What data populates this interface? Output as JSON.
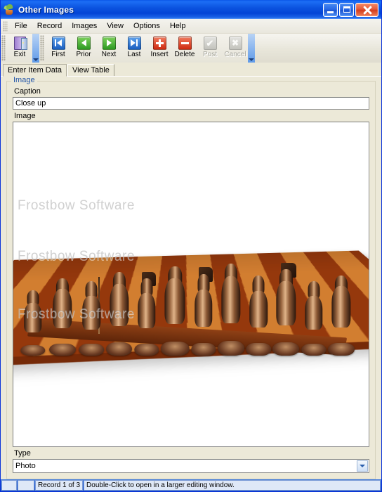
{
  "window": {
    "title": "Other Images",
    "icon": "plant-pot-icon",
    "controls": {
      "minimize": "minimize-button",
      "maximize": "maximize-button",
      "close": "close-button"
    }
  },
  "menu": {
    "items": [
      {
        "label": "File",
        "accel": "F"
      },
      {
        "label": "Record",
        "accel": "R"
      },
      {
        "label": "Images",
        "accel": "I"
      },
      {
        "label": "View",
        "accel": "V"
      },
      {
        "label": "Options",
        "accel": "O"
      },
      {
        "label": "Help",
        "accel": "H"
      }
    ]
  },
  "toolbar": {
    "groups": [
      {
        "name": "file-group",
        "buttons": [
          {
            "label": "Exit",
            "icon": "exit-door-icon",
            "enabled": true
          }
        ]
      },
      {
        "name": "navigation-group",
        "buttons": [
          {
            "label": "First",
            "icon": "first-record-icon",
            "enabled": true
          },
          {
            "label": "Prior",
            "icon": "prior-record-icon",
            "enabled": true
          },
          {
            "label": "Next",
            "icon": "next-record-icon",
            "enabled": true
          },
          {
            "label": "Last",
            "icon": "last-record-icon",
            "enabled": true
          }
        ]
      },
      {
        "name": "edit-group",
        "buttons": [
          {
            "label": "Insert",
            "icon": "insert-plus-icon",
            "enabled": true
          },
          {
            "label": "Delete",
            "icon": "delete-minus-icon",
            "enabled": true
          },
          {
            "label": "Post",
            "icon": "post-check-icon",
            "enabled": false
          },
          {
            "label": "Cancel",
            "icon": "cancel-x-icon",
            "enabled": false
          }
        ]
      }
    ]
  },
  "tabs": {
    "items": [
      {
        "label": "Enter Item Data",
        "active": true
      },
      {
        "label": "View Table",
        "active": false
      }
    ]
  },
  "form": {
    "groupbox_title": "Image",
    "caption": {
      "label": "Caption",
      "value": "Close up",
      "placeholder": ""
    },
    "image": {
      "label": "Image",
      "watermark": "Frostbow Software",
      "subject": "chess-set-photo"
    },
    "type": {
      "label": "Type",
      "value": "Photo",
      "options": [
        "Photo"
      ]
    }
  },
  "statusbar": {
    "panel1": "",
    "panel2": "",
    "record": "Record 1 of 3",
    "hint": "Double-Click to open in a larger editing window."
  },
  "colors": {
    "title_bar": "#0a56e8",
    "panel_bg": "#ece9d8",
    "group_title": "#2356a8",
    "status_bar": "#2b63d4",
    "accent_blue": "#1b5fc0",
    "accent_green": "#2e9a22",
    "accent_red": "#ce2a11"
  }
}
